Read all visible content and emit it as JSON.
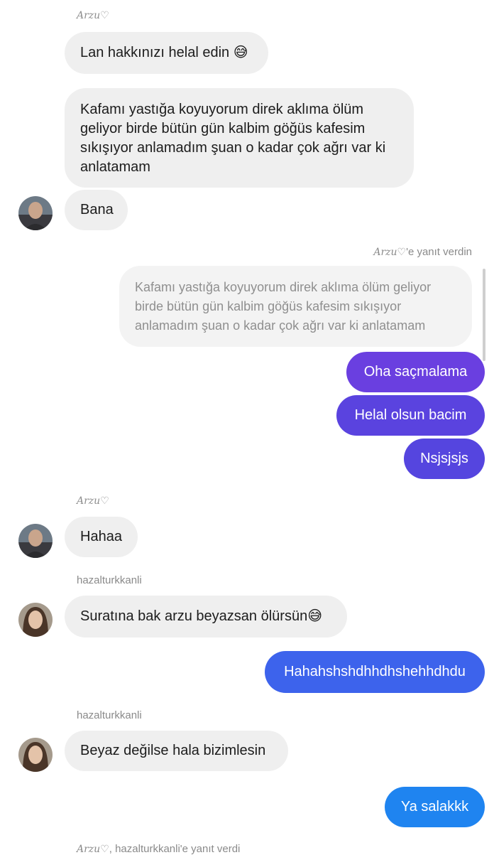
{
  "messages": {
    "m1": {
      "sender": "Arzu♡",
      "text": "Lan hakkınızı helal edin 😅"
    },
    "m2": {
      "text": "Kafamı yastığa koyuyorum direk aklıma ölüm geliyor birde bütün gün kalbim göğüs kafesim sıkışıyor anlamadım şuan o kadar çok ağrı var ki anlatamam"
    },
    "m3": {
      "text": "Bana"
    },
    "reply1": {
      "who": "Arzu♡",
      "suffix": "'e yanıt verdin",
      "quoted": "Kafamı yastığa koyuyorum direk aklıma ölüm geliyor birde bütün gün kalbim göğüs kafesim sıkışıyor anlamadım şuan o kadar çok ağrı var ki anlatamam"
    },
    "out1": {
      "text": "Oha saçmalama"
    },
    "out2": {
      "text": "Helal olsun bacim"
    },
    "out3": {
      "text": "Nsjsjsjs"
    },
    "m4": {
      "sender": "Arzu♡",
      "text": "Hahaa"
    },
    "m5": {
      "sender": "hazalturkkanli",
      "text": "Suratına bak arzu beyazsan ölürsün😅"
    },
    "out4": {
      "text": "Hahahshshdhhdhshehhdhdu"
    },
    "m6": {
      "sender": "hazalturkkanli",
      "text": "Beyaz değilse hala bizimlesin"
    },
    "out5": {
      "text": "Ya salakkk"
    },
    "footer": {
      "who": "Arzu♡",
      "rest": ", hazalturkkanli'e yanıt verdi"
    }
  },
  "colors": {
    "incoming_bubble": "#efefef",
    "outgoing_purple": "#6a3fe0",
    "outgoing_violet": "#5a43df",
    "outgoing_blue": "#3d63ec",
    "outgoing_sky": "#1f84f0"
  }
}
